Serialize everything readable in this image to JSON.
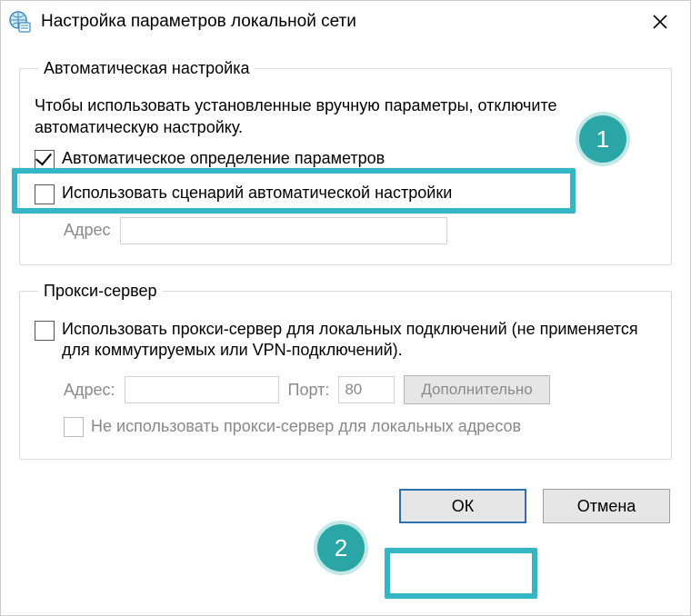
{
  "window": {
    "title": "Настройка параметров локальной сети"
  },
  "auto": {
    "legend": "Автоматическая настройка",
    "description": "Чтобы использовать установленные вручную параметры, отключите автоматическую настройку.",
    "detect_label": "Автоматическое определение параметров",
    "detect_checked": true,
    "script_label": "Использовать сценарий автоматической настройки",
    "script_checked": false,
    "address_label": "Адрес",
    "address_value": ""
  },
  "proxy": {
    "legend": "Прокси-сервер",
    "use_label": "Использовать прокси-сервер для локальных подключений (не применяется для коммутируемых или VPN-подключений).",
    "use_checked": false,
    "address_label": "Адрес:",
    "address_value": "",
    "port_label": "Порт:",
    "port_value": "80",
    "advanced_label": "Дополнительно",
    "bypass_label": "Не использовать прокси-сервер для локальных адресов",
    "bypass_checked": false
  },
  "buttons": {
    "ok": "ОК",
    "cancel": "Отмена"
  },
  "annotations": {
    "badge1": "1",
    "badge2": "2"
  }
}
